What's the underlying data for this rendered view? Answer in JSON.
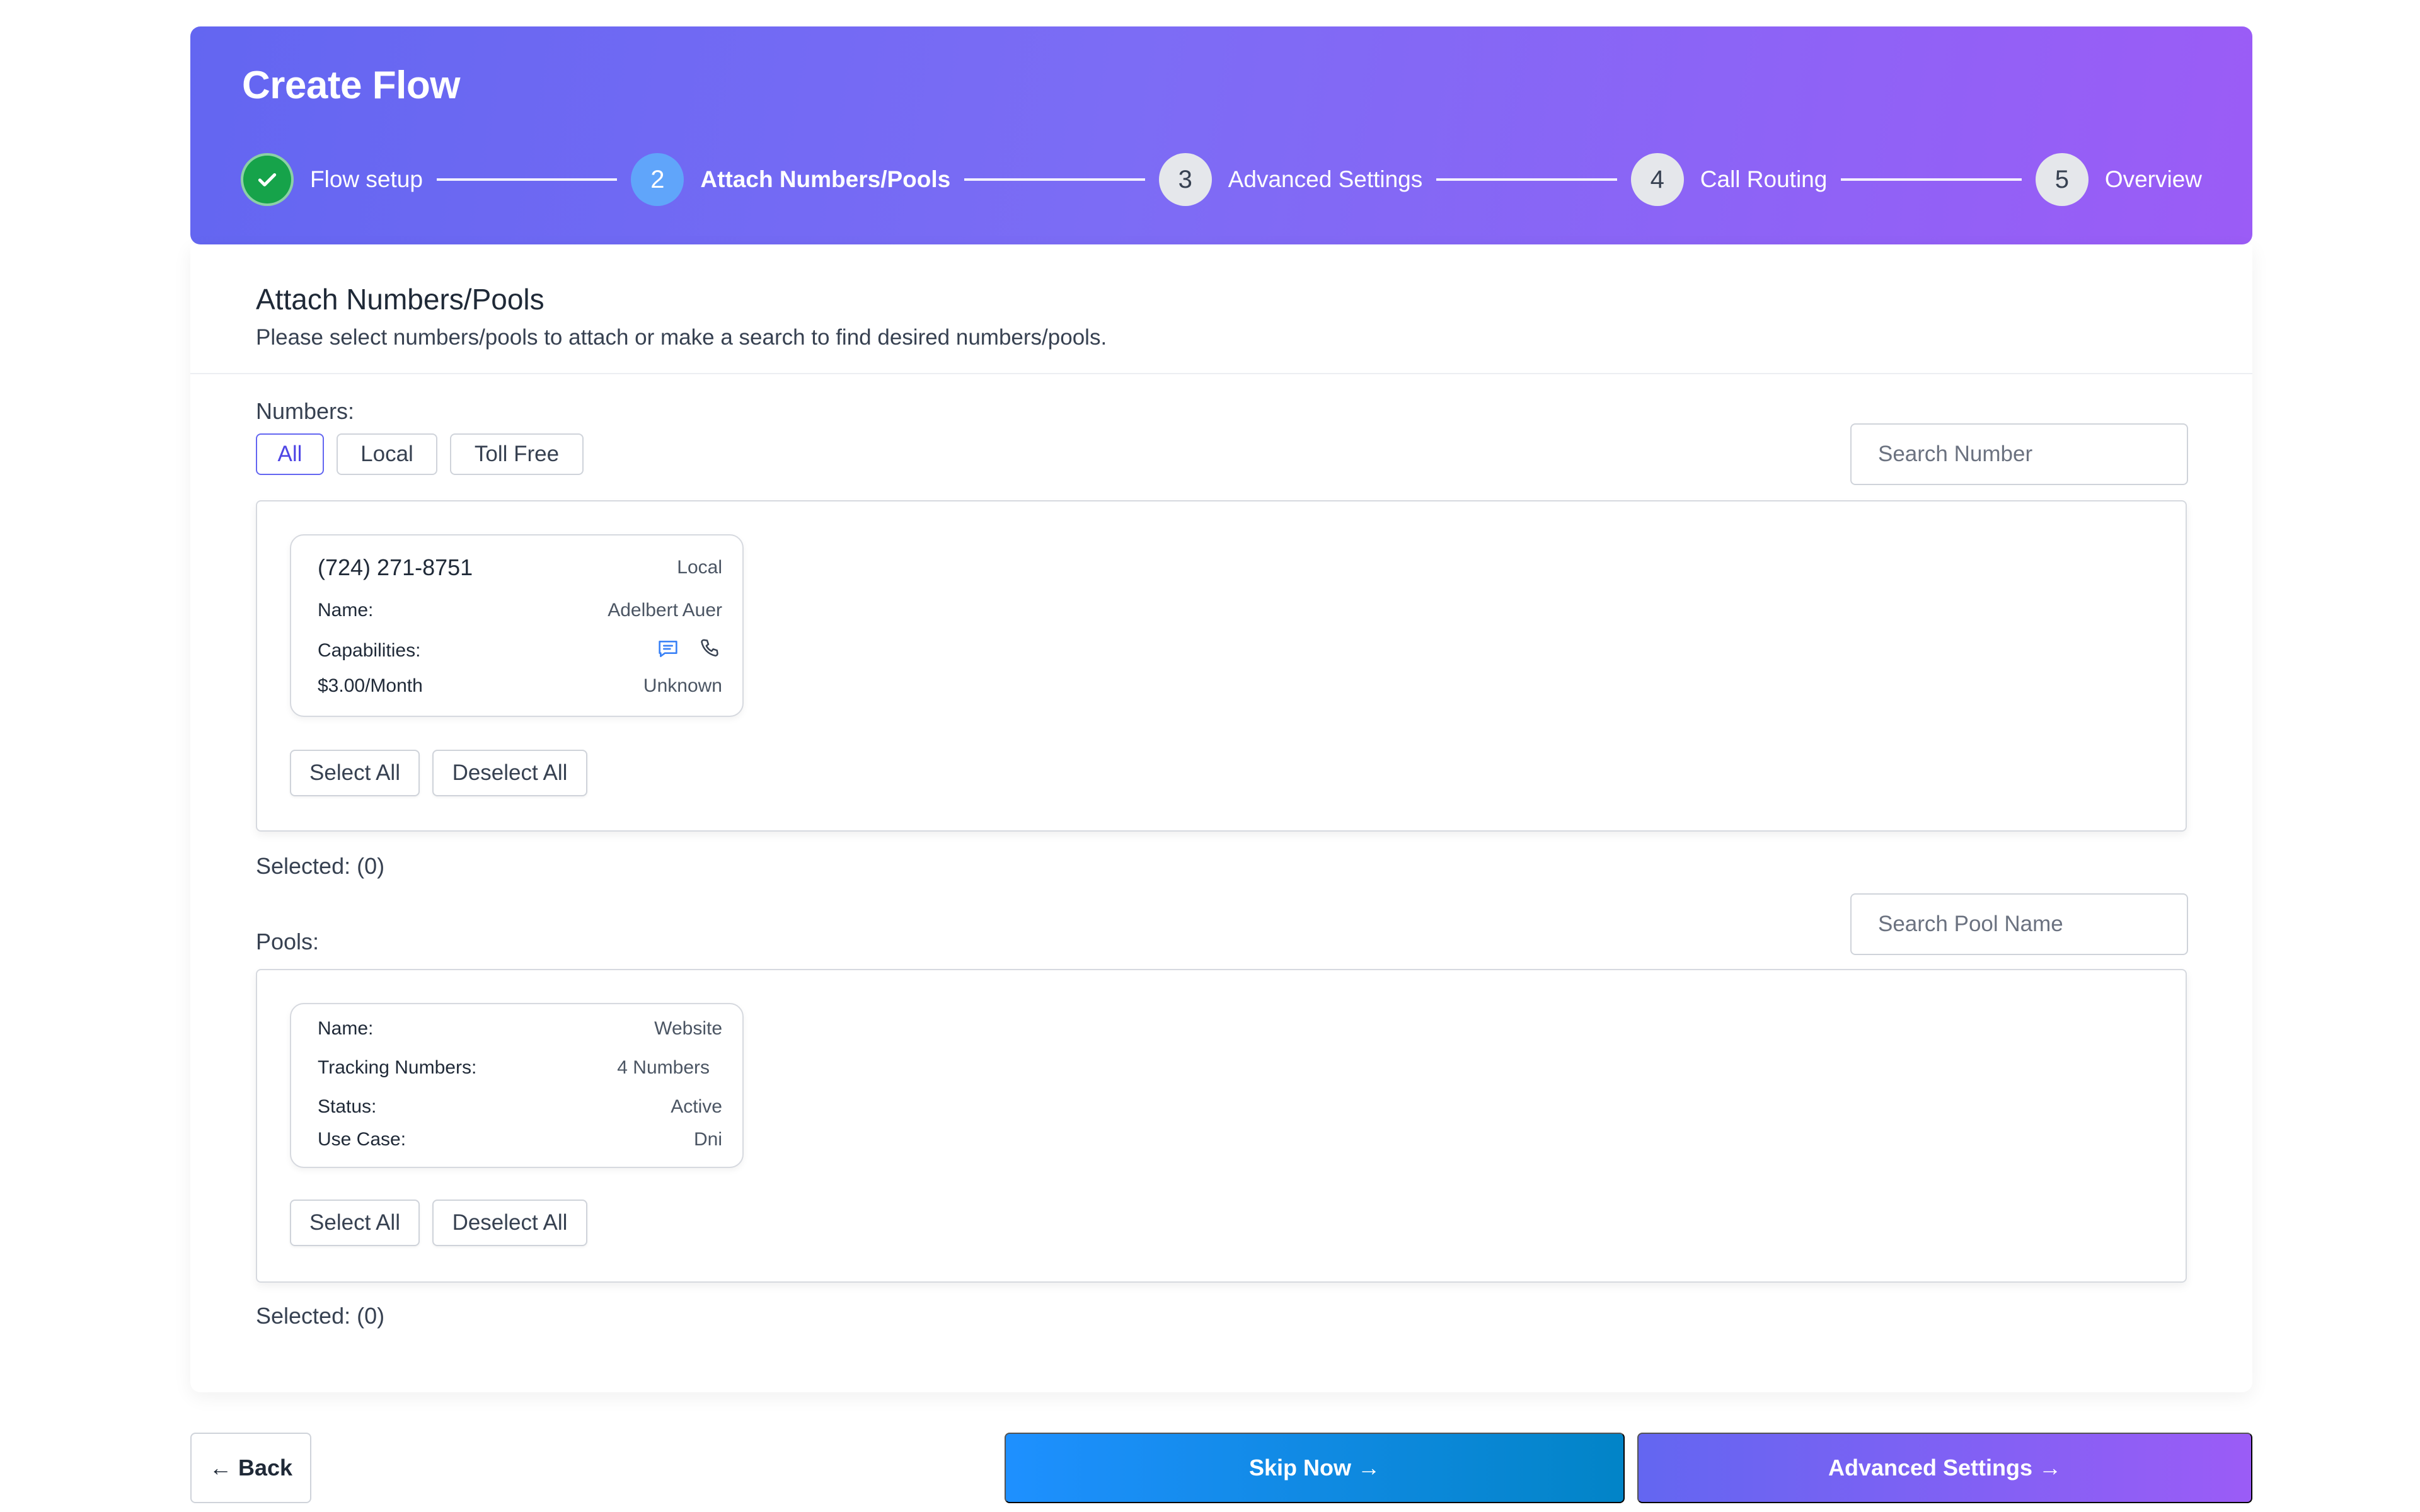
{
  "header": {
    "title": "Create Flow",
    "steps": [
      {
        "num": "",
        "label": "Flow setup",
        "state": "done"
      },
      {
        "num": "2",
        "label": "Attach Numbers/Pools",
        "state": "active"
      },
      {
        "num": "3",
        "label": "Advanced Settings",
        "state": "todo"
      },
      {
        "num": "4",
        "label": "Call Routing",
        "state": "todo"
      },
      {
        "num": "5",
        "label": "Overview",
        "state": "todo"
      }
    ]
  },
  "section": {
    "title": "Attach Numbers/Pools",
    "subtitle": "Please select numbers/pools to attach or make a search to find desired numbers/pools."
  },
  "numbers": {
    "label": "Numbers:",
    "filters": [
      "All",
      "Local",
      "Toll Free"
    ],
    "active_filter": "All",
    "search_placeholder": "Search Number",
    "card": {
      "phone": "(724) 271-8751",
      "type": "Local",
      "name_label": "Name:",
      "name_value": "Adelbert Auer",
      "capabilities_label": "Capabilities:",
      "capabilities": [
        "sms-icon",
        "phone-icon"
      ],
      "price": "$3.00/Month",
      "status": "Unknown"
    },
    "select_all": "Select All",
    "deselect_all": "Deselect All",
    "selected": "Selected: (0)"
  },
  "pools": {
    "label": "Pools:",
    "search_placeholder": "Search Pool Name",
    "card": {
      "name_label": "Name:",
      "name_value": "Website",
      "tracking_label": "Tracking Numbers:",
      "tracking_value": "4 Numbers",
      "status_label": "Status:",
      "status_value": "Active",
      "usecase_label": "Use Case:",
      "usecase_value": "Dni"
    },
    "select_all": "Select All",
    "deselect_all": "Deselect All",
    "selected": "Selected: (0)"
  },
  "footer": {
    "back": "← Back",
    "skip": "Skip Now →",
    "advanced": "Advanced Settings →"
  },
  "colors": {
    "header_start": "#6366f1",
    "header_end": "#9b5cf6",
    "done_green": "#16a34a",
    "active_blue": "#60a5fa",
    "skip_blue": "#1e90ff",
    "capability_blue": "#3b82f6"
  }
}
